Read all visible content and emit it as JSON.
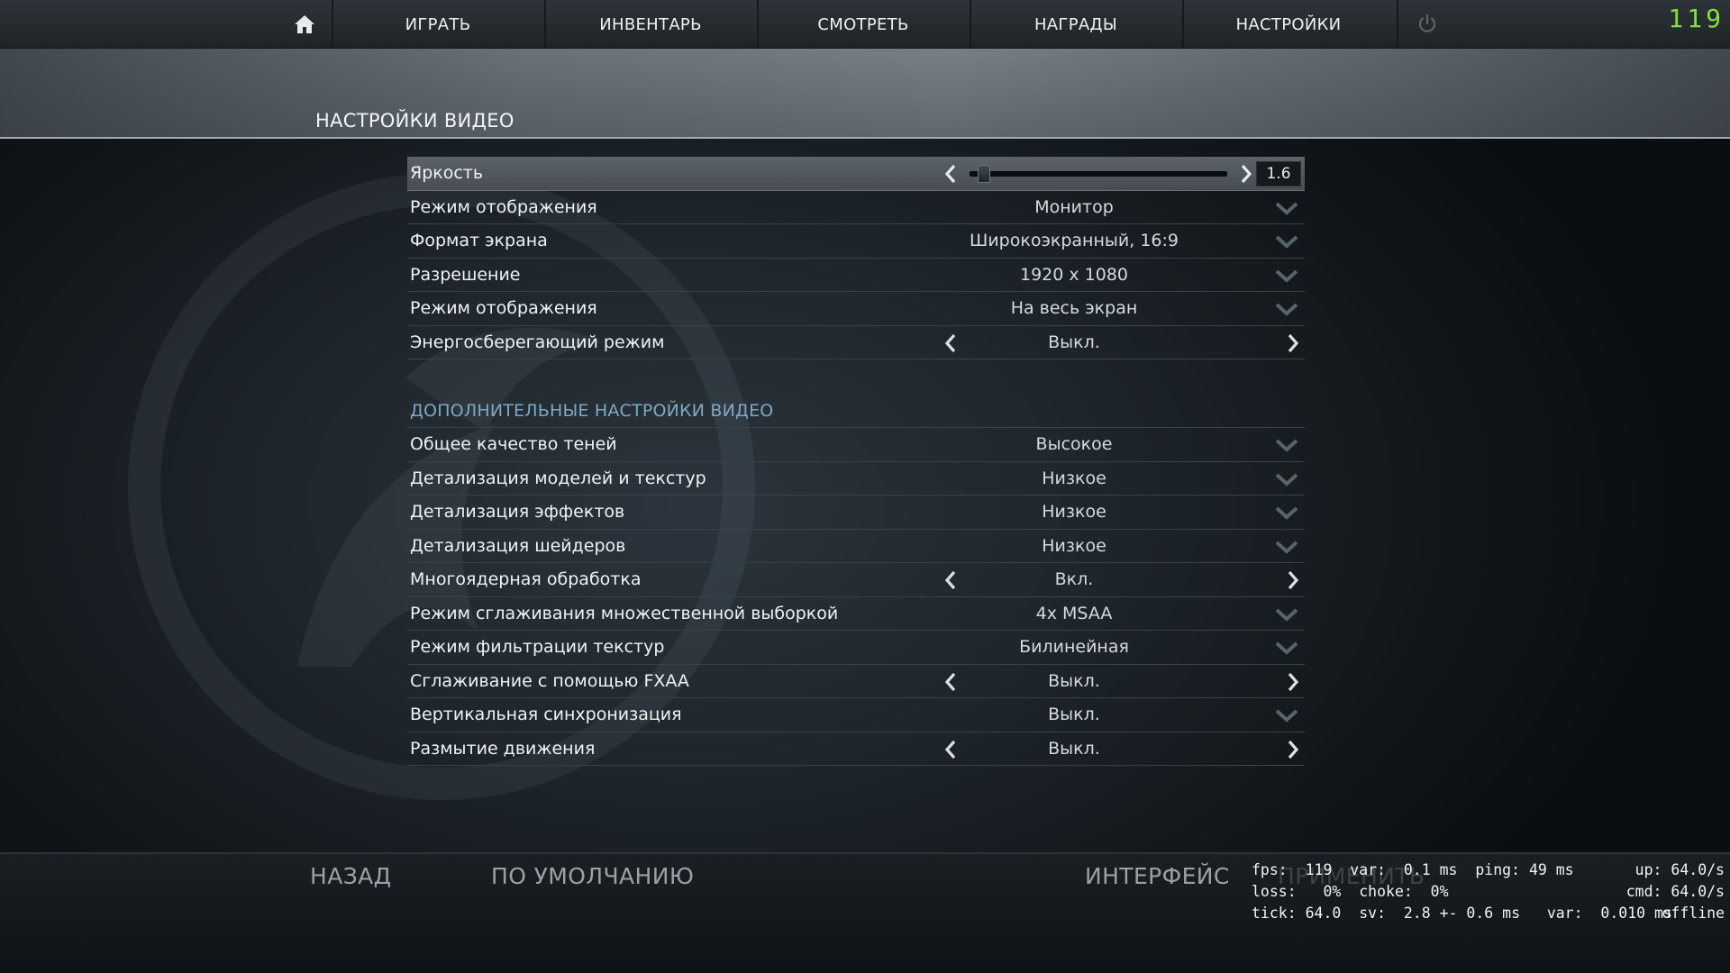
{
  "nav": {
    "items": [
      {
        "label": "ИГРАТЬ"
      },
      {
        "label": "ИНВЕНТАРЬ"
      },
      {
        "label": "СМОТРЕТЬ"
      },
      {
        "label": "НАГРАДЫ"
      },
      {
        "label": "НАСТРОЙКИ"
      }
    ],
    "home_icon": "home-icon",
    "power_icon": "power-icon"
  },
  "fps_counter": "119",
  "page_title": "НАСТРОЙКИ ВИДЕО",
  "brightness": {
    "label": "Яркость",
    "value": "1.6",
    "fraction": 0.03
  },
  "basic_settings": [
    {
      "label": "Режим отображения",
      "value": "Монитор",
      "control": "dropdown"
    },
    {
      "label": "Формат экрана",
      "value": "Широкоэкранный, 16:9",
      "control": "dropdown"
    },
    {
      "label": "Разрешение",
      "value": "1920 x 1080",
      "control": "dropdown"
    },
    {
      "label": "Режим отображения",
      "value": "На весь экран",
      "control": "dropdown"
    },
    {
      "label": "Энергосберегающий режим",
      "value": "Выкл.",
      "control": "toggle"
    }
  ],
  "advanced_title": "ДОПОЛНИТЕЛЬНЫЕ НАСТРОЙКИ ВИДЕО",
  "advanced_settings": [
    {
      "label": "Общее качество теней",
      "value": "Высокое",
      "control": "dropdown"
    },
    {
      "label": "Детализация моделей и текстур",
      "value": "Низкое",
      "control": "dropdown"
    },
    {
      "label": "Детализация эффектов",
      "value": "Низкое",
      "control": "dropdown"
    },
    {
      "label": "Детализация шейдеров",
      "value": "Низкое",
      "control": "dropdown"
    },
    {
      "label": "Многоядерная обработка",
      "value": "Вкл.",
      "control": "toggle"
    },
    {
      "label": "Режим сглаживания множественной выборкой",
      "value": "4x MSAA",
      "control": "dropdown"
    },
    {
      "label": "Режим фильтрации текстур",
      "value": "Билинейная",
      "control": "dropdown"
    },
    {
      "label": "Сглаживание с помощью FXAA",
      "value": "Выкл.",
      "control": "toggle"
    },
    {
      "label": "Вертикальная синхронизация",
      "value": "Выкл.",
      "control": "dropdown"
    },
    {
      "label": "Размытие движения",
      "value": "Выкл.",
      "control": "toggle"
    }
  ],
  "bottom": {
    "back": "НАЗАД",
    "defaults": "ПО УМОЛЧАНИЮ",
    "interface": "ИНТЕРФЕЙС",
    "apply": "ПРИМЕНИТЬ"
  },
  "netgraph": {
    "line1": "fps:  119  var:  0.1 ms  ping: 49 ms",
    "line2": "loss:   0%  choke:  0%",
    "line3": "tick: 64.0  sv:  2.8 +- 0.6 ms   var:  0.010 ms",
    "right1": "up: 64.0/s",
    "right2": "cmd: 64.0/s",
    "right3": "offline"
  },
  "colors": {
    "accent_section": "#7fa8c4",
    "fps_green": "#7fe23a"
  }
}
